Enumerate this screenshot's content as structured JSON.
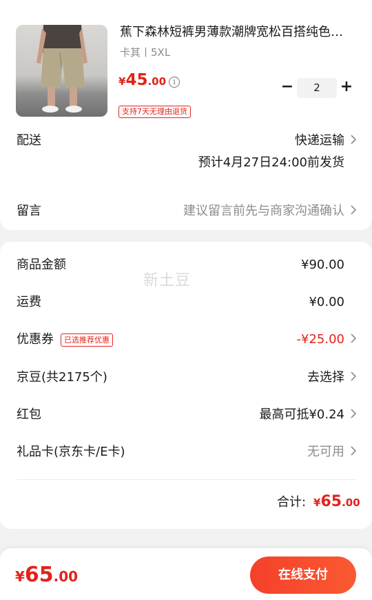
{
  "product": {
    "title": "蕉下森林短裤男薄款潮牌宽松百搭纯色五分裤",
    "spec": "卡其丨5XL",
    "price_symbol": "¥",
    "price_int": "45",
    "price_dec": ".00",
    "info_icon": "ⓘ",
    "quantity": "2",
    "minus": "−",
    "plus": "+",
    "return_badge": "支持7天无理由退货"
  },
  "delivery": {
    "label": "配送",
    "method": "快递运输",
    "estimate": "预计4月27日24:00前发货"
  },
  "message": {
    "label": "留言",
    "placeholder": "建议留言前先与商家沟通确认"
  },
  "summary": {
    "watermark": "新土豆",
    "rows": [
      {
        "label": "商品金额",
        "value": "¥90.00"
      },
      {
        "label": "运费",
        "value": "¥0.00"
      },
      {
        "label": "优惠券",
        "badge": "已选推荐优惠",
        "value": "-¥25.00"
      },
      {
        "label": "京豆(共2175个)",
        "value": "去选择"
      },
      {
        "label": "红包",
        "value": "最高可抵¥0.24"
      },
      {
        "label": "礼品卡(京东卡/E卡)",
        "value": "无可用"
      }
    ],
    "total_label": "合计:",
    "total_symbol": "¥",
    "total_int": "65",
    "total_dec": ".00"
  },
  "bottom_bar": {
    "price_symbol": "¥",
    "price_int": "65",
    "price_dec": ".00",
    "pay_label": "在线支付"
  },
  "colors": {
    "accent": "#e2231a",
    "pay_button": "#f5402a",
    "background": "#f2f2f2"
  },
  "icons": [
    "info-icon",
    "chevron-right-icon",
    "minus-icon",
    "plus-icon"
  ]
}
